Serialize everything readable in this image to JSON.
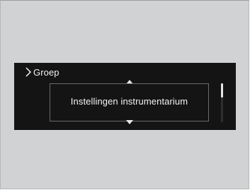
{
  "display": {
    "header": {
      "label": "Groep",
      "icon": "chevron-right-icon"
    },
    "menu": {
      "selected_item": "Instellingen instrumentarium",
      "up_icon": "arrow-up-icon",
      "down_icon": "arrow-down-icon"
    },
    "scroll_position": 0
  },
  "colors": {
    "frame_background": "#d1d2d4",
    "display_background": "#141414",
    "text": "#f4f4f4",
    "box_border": "#6a6a6a"
  }
}
